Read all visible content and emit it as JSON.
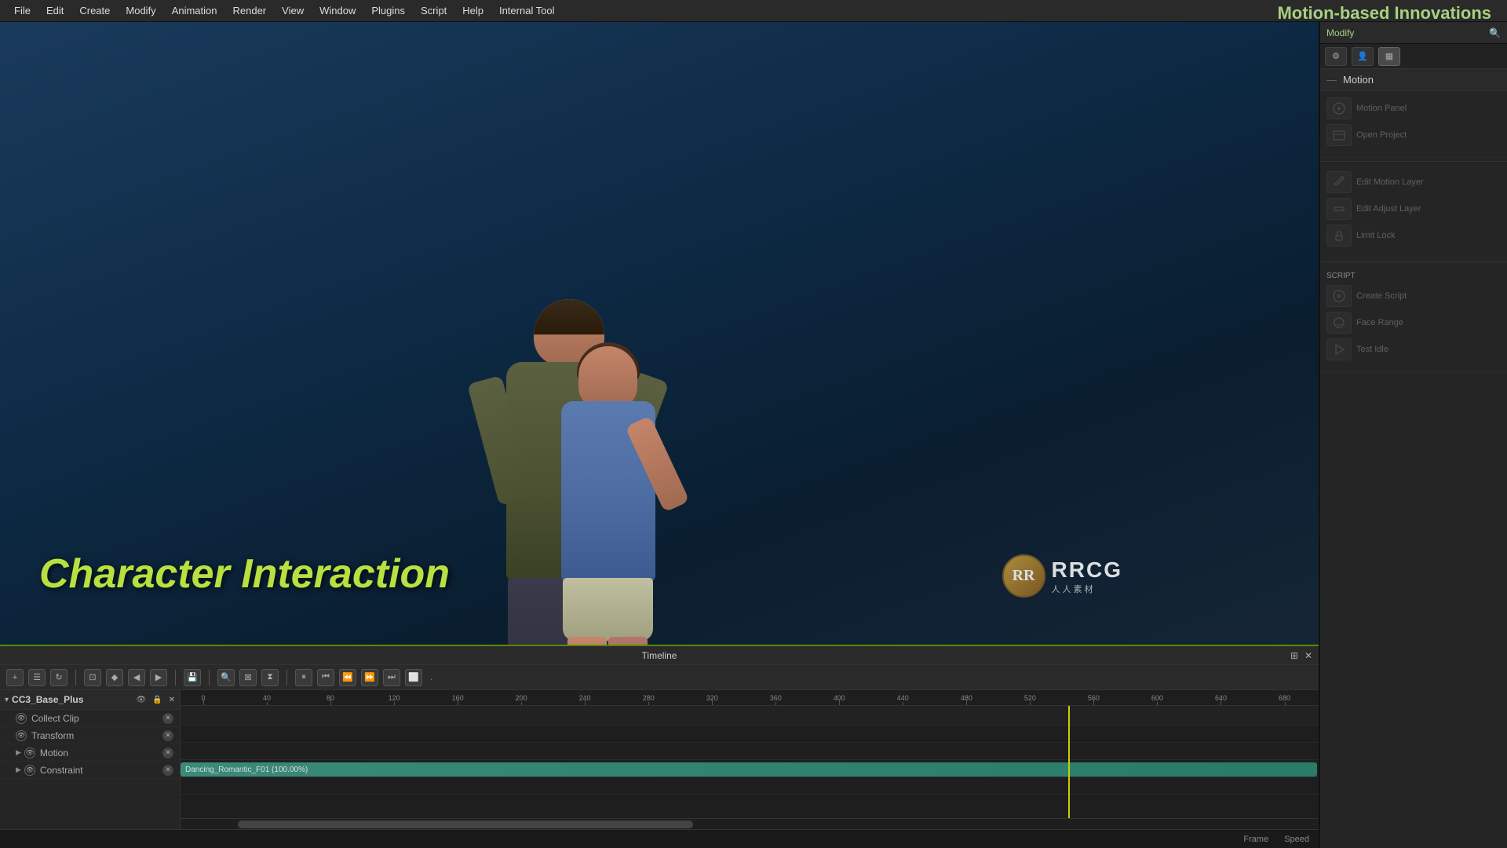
{
  "app": {
    "title": "Motion-based Innovations",
    "subtitle": "Modify"
  },
  "menubar": {
    "items": [
      "File",
      "Edit",
      "Create",
      "Modify",
      "Animation",
      "Render",
      "View",
      "Window",
      "Plugins",
      "Script",
      "Help",
      "Internal Tool"
    ]
  },
  "viewport": {
    "overlay_text": "Character Interaction"
  },
  "timeline": {
    "title": "Timeline",
    "tracks": [
      {
        "label": "CC3_Base_Plus",
        "type": "main",
        "indent": 0
      },
      {
        "label": "Collect Clip",
        "type": "sub",
        "indent": 1
      },
      {
        "label": "Transform",
        "type": "sub",
        "indent": 1
      },
      {
        "label": "Motion",
        "type": "sub-expandable",
        "indent": 1
      },
      {
        "label": "Constraint",
        "type": "sub-expandable",
        "indent": 1
      }
    ],
    "motion_clip": {
      "label": "Dancing_Romantic_F01 (100.00%)",
      "color": "#3a8a7a"
    },
    "ruler_marks": [
      "0",
      "40",
      "80",
      "120",
      "160",
      "200",
      "240",
      "280",
      "320",
      "360",
      "400",
      "440",
      "480",
      "520",
      "560",
      "600",
      "640",
      "680"
    ],
    "playhead_position": "580"
  },
  "right_panel": {
    "title": "Modify",
    "motion_label": "Motion",
    "sections": [
      {
        "header": "",
        "buttons": [
          {
            "icon": "👤",
            "label": "Motion Panel"
          },
          {
            "icon": "📂",
            "label": "Open Project"
          }
        ]
      },
      {
        "header": "",
        "buttons": [
          {
            "icon": "✏️",
            "label": "Edit Motion Layer"
          },
          {
            "icon": "✂️",
            "label": "Edit Adjust Layer"
          },
          {
            "icon": "🔗",
            "label": "Limit Lock"
          }
        ]
      },
      {
        "header": "Script",
        "buttons": [
          {
            "icon": "📜",
            "label": "Create Script"
          },
          {
            "icon": "📄",
            "label": "Face Range"
          },
          {
            "icon": "▶️",
            "label": "Test Idle"
          }
        ]
      }
    ]
  },
  "status_bar": {
    "frame_label": "Frame",
    "speed_label": "Speed"
  },
  "watermark": {
    "logo": "RR",
    "brand1": "RRCG",
    "brand2": "人人素材"
  }
}
